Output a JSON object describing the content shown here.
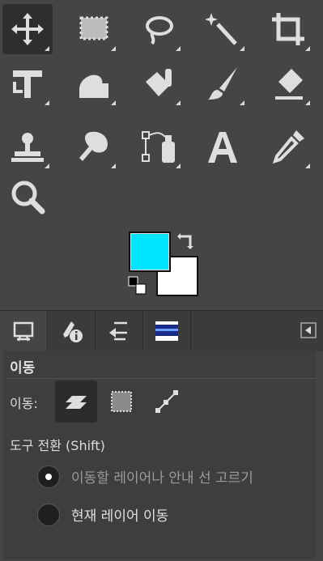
{
  "tools": [
    {
      "name": "move-tool-icon",
      "selected": true
    },
    {
      "name": "rect-select-tool-icon"
    },
    {
      "name": "free-select-tool-icon"
    },
    {
      "name": "fuzzy-select-tool-icon"
    },
    {
      "name": "crop-tool-icon"
    },
    {
      "name": "transform-tool-icon"
    },
    {
      "name": "warp-tool-icon"
    },
    {
      "name": "bucket-fill-tool-icon"
    },
    {
      "name": "paintbrush-tool-icon"
    },
    {
      "name": "eraser-tool-icon"
    },
    {
      "name": "clone-tool-icon"
    },
    {
      "name": "smudge-tool-icon"
    },
    {
      "name": "paths-tool-icon"
    },
    {
      "name": "text-tool-icon"
    },
    {
      "name": "color-picker-tool-icon"
    },
    {
      "name": "zoom-tool-icon"
    }
  ],
  "colors": {
    "foreground": "#00e5ff",
    "background": "#ffffff"
  },
  "tabs": [
    {
      "name": "tool-options-tab-icon",
      "active": true
    },
    {
      "name": "device-status-tab-icon"
    },
    {
      "name": "undo-history-tab-icon"
    },
    {
      "name": "images-tab-icon"
    }
  ],
  "options": {
    "title": "이동",
    "move_label": "이동:",
    "modes": [
      "layer-mode-icon",
      "selection-mode-icon",
      "path-mode-icon"
    ],
    "toggle_label": "도구 전환  (Shift)",
    "radio_options": [
      "이동할 레이어나 안내 선 고르기",
      "현재 레이어 이동"
    ],
    "radio_selected": 0
  }
}
